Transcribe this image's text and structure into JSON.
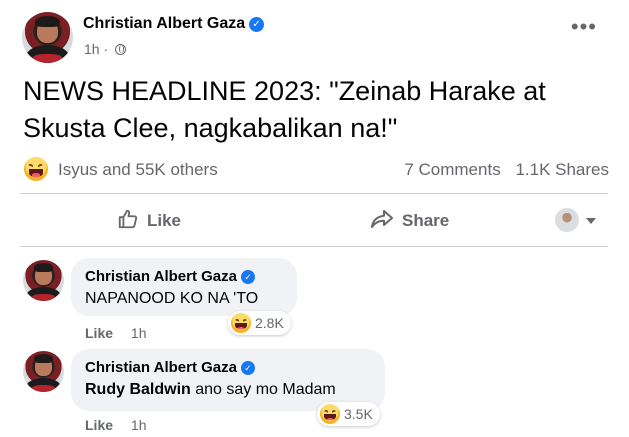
{
  "post": {
    "author": "Christian Albert Gaza",
    "time": "1h",
    "separator": "·",
    "headline": "NEWS HEADLINE 2023: \"Zeinab Harake at Skusta Clee, nagkabalikan na!\"",
    "reactions_text": "Isyus and 55K others",
    "comments_count": "7 Comments",
    "shares_count": "1.1K Shares"
  },
  "actions": {
    "like_label": "Like",
    "share_label": "Share"
  },
  "comments": [
    {
      "author": "Christian Albert Gaza",
      "text": "NAPANOOD KO NA 'TO",
      "reaction_count": "2.8K",
      "like_label": "Like",
      "time": "1h"
    },
    {
      "author": "Christian Albert Gaza",
      "mention": "Rudy Baldwin",
      "text": " ano say mo Madam",
      "reaction_count": "3.5K",
      "like_label": "Like",
      "time": "1h"
    }
  ],
  "icons": {
    "verified": "verified-badge-icon",
    "globe": "globe-icon",
    "more": "more-options-icon",
    "reaction": "haha-reaction-icon",
    "like": "thumbs-up-icon",
    "share": "share-arrow-icon",
    "audience": "avatar-dropdown-icon"
  },
  "colors": {
    "verified_blue": "#1877f2",
    "secondary_text": "#65676b",
    "bubble_bg": "#f0f2f5",
    "divider": "#ced0d4"
  }
}
